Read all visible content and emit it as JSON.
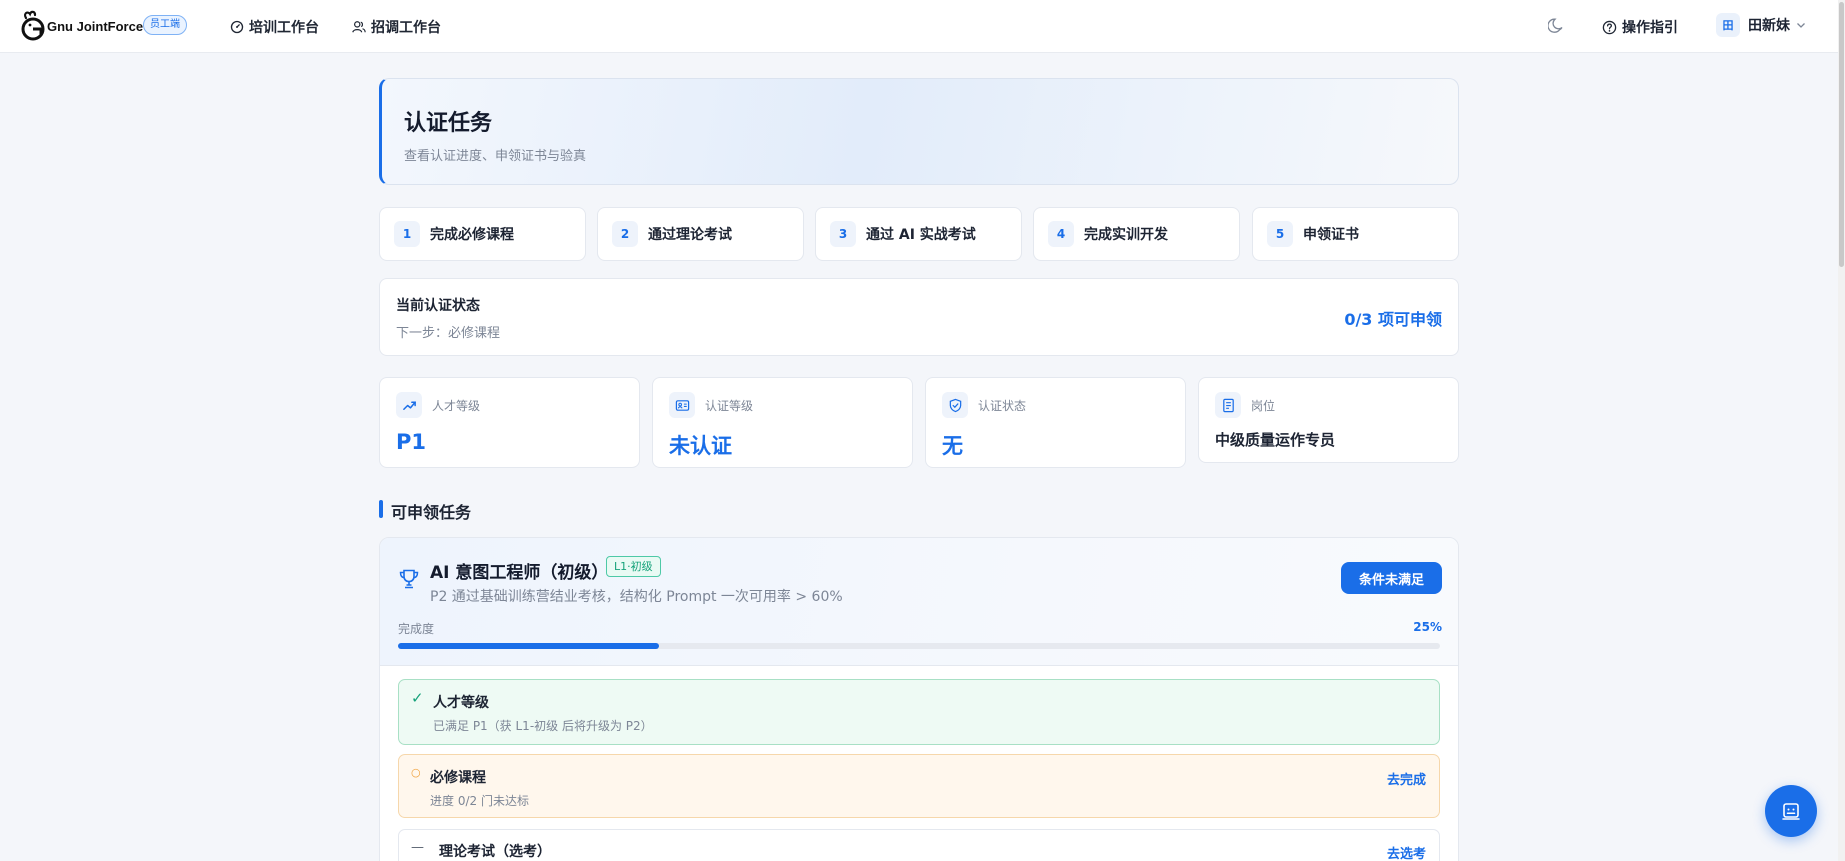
{
  "header": {
    "logo_text": "Gnu JointForce",
    "role_badge": "员工端",
    "nav": [
      {
        "label": "培训工作台",
        "icon": "dashboard-icon"
      },
      {
        "label": "招调工作台",
        "icon": "people-icon"
      }
    ],
    "guide_label": "操作指引",
    "avatar_text": "田",
    "user_name": "田新妹"
  },
  "hero": {
    "title": "认证任务",
    "subtitle": "查看认证进度、申领证书与验真"
  },
  "steps": [
    {
      "num": "1",
      "label": "完成必修课程"
    },
    {
      "num": "2",
      "label": "通过理论考试"
    },
    {
      "num": "3",
      "label": "通过 AI 实战考试"
    },
    {
      "num": "4",
      "label": "完成实训开发"
    },
    {
      "num": "5",
      "label": "申领证书"
    }
  ],
  "status": {
    "title": "当前认证状态",
    "next": "下一步：必修课程",
    "count": "0/3 项可申领"
  },
  "stats": [
    {
      "label": "人才等级",
      "value": "P1",
      "icon": "trend-up-icon"
    },
    {
      "label": "认证等级",
      "value": "未认证",
      "icon": "id-card-icon"
    },
    {
      "label": "认证状态",
      "value": "无",
      "icon": "shield-check-icon"
    },
    {
      "label": "岗位",
      "value": "中级质量运作专员",
      "icon": "document-icon"
    }
  ],
  "section_title": "可申领任务",
  "task": {
    "title": "AI 意图工程师（初级）",
    "level": "L1·初级",
    "desc": "P2 通过基础训练营结业考核，结构化 Prompt 一次可用率 > 60%",
    "button": "条件未满足",
    "progress_label": "完成度",
    "progress_text": "25%",
    "progress": 0.25,
    "requirements": [
      {
        "mark": "✓",
        "title": "人才等级",
        "desc": "已满足 P1（获 L1-初级 后将升级为 P2）",
        "state": "done"
      },
      {
        "mark": "○",
        "title": "必修课程",
        "desc": "进度 0/2 门未达标",
        "action": "去完成",
        "state": "pending"
      },
      {
        "mark": "—",
        "title": "理论考试（选考）",
        "action": "去选考",
        "state": "optional"
      }
    ]
  },
  "colors": {
    "accent": "#1a6ee8",
    "success": "#15a27a",
    "warning": "#f0a03a"
  }
}
